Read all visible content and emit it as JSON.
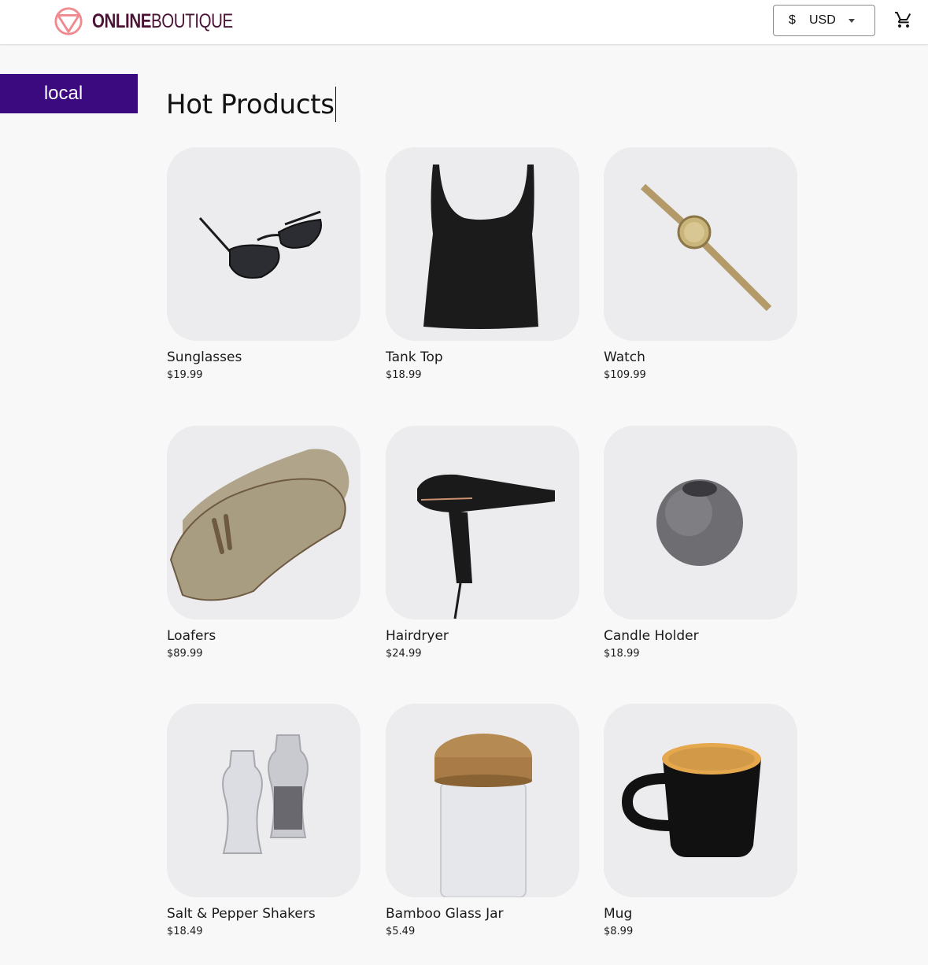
{
  "header": {
    "logo_online": "ONLINE",
    "logo_boutique": "BOUTIQUE",
    "currency_symbol": "$",
    "currency_code": "USD"
  },
  "badge": {
    "label": "local"
  },
  "page": {
    "title": "Hot Products"
  },
  "products": [
    {
      "name": "Sunglasses",
      "price": "$19.99"
    },
    {
      "name": "Tank Top",
      "price": "$18.99"
    },
    {
      "name": "Watch",
      "price": "$109.99"
    },
    {
      "name": "Loafers",
      "price": "$89.99"
    },
    {
      "name": "Hairdryer",
      "price": "$24.99"
    },
    {
      "name": "Candle Holder",
      "price": "$18.99"
    },
    {
      "name": "Salt & Pepper Shakers",
      "price": "$18.49"
    },
    {
      "name": "Bamboo Glass Jar",
      "price": "$5.49"
    },
    {
      "name": "Mug",
      "price": "$8.99"
    }
  ],
  "colors": {
    "logo": "#4a1335",
    "logo_mark": "#f08a8f",
    "badge_bg": "#3a0a7e",
    "page_bg": "#f8f8f8"
  },
  "icons": [
    "logo-icon",
    "caret-down-icon",
    "cart-icon"
  ]
}
